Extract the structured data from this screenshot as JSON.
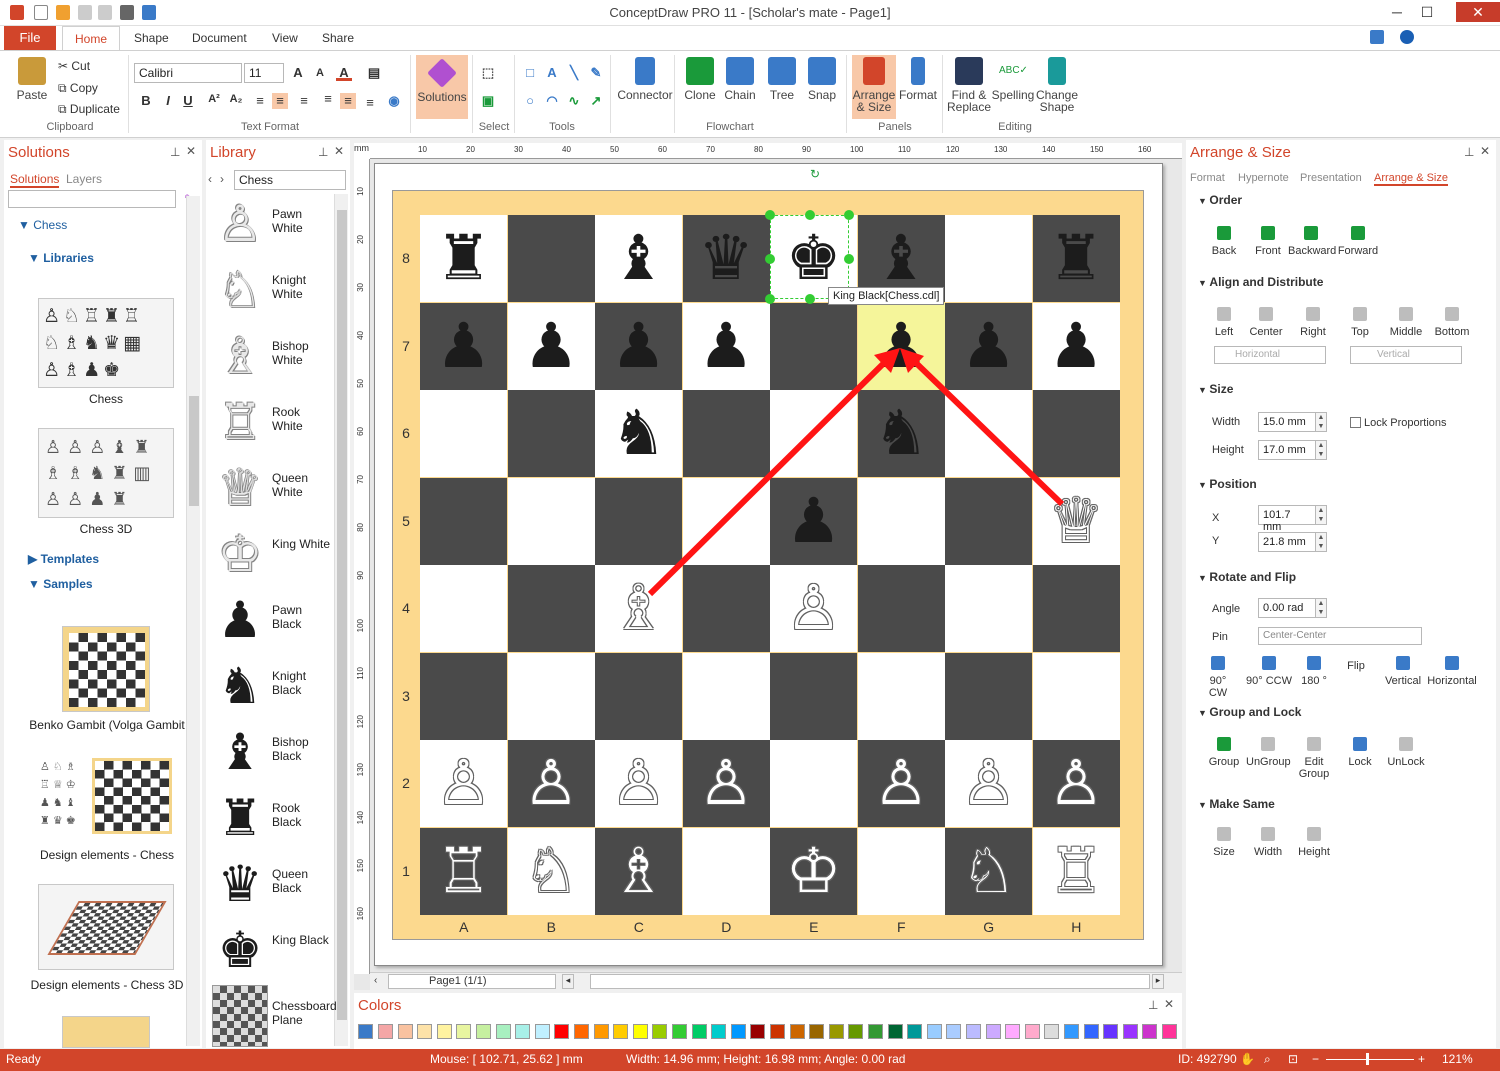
{
  "window": {
    "title": "ConceptDraw PRO 11 - [Scholar's mate - Page1]"
  },
  "tabs": [
    "File",
    "Home",
    "Shape",
    "Document",
    "View",
    "Share"
  ],
  "ribbon": {
    "clipboard": {
      "paste": "Paste",
      "cut": "Cut",
      "copy": "Copy",
      "duplicate": "Duplicate",
      "label": "Clipboard"
    },
    "text_format": {
      "font": "Calibri",
      "size": "11",
      "label": "Text Format"
    },
    "solutions": "Solutions",
    "select_label": "Select",
    "tools_label": "Tools",
    "connector": "Connector",
    "flowchart": {
      "clone": "Clone",
      "chain": "Chain",
      "tree": "Tree",
      "snap": "Snap",
      "label": "Flowchart"
    },
    "panels": {
      "arrange": "Arrange & Size",
      "format": "Format",
      "label": "Panels"
    },
    "editing": {
      "find": "Find & Replace",
      "spelling": "Spelling",
      "change": "Change Shape",
      "label": "Editing"
    }
  },
  "solutions_panel": {
    "title": "Solutions",
    "tabs": [
      "Solutions",
      "Layers"
    ],
    "tree": {
      "root": "Chess",
      "libraries": "Libraries",
      "lib_thumbs": [
        "Chess",
        "Chess 3D"
      ],
      "templates": "Templates",
      "samples": "Samples",
      "sample_thumbs": [
        "Benko Gambit (Volga Gambit",
        "Design elements - Chess",
        "Design elements - Chess 3D"
      ]
    }
  },
  "library_panel": {
    "title": "Library",
    "selected": "Chess",
    "items": [
      {
        "label": "Pawn White",
        "glyph": "♙"
      },
      {
        "label": "Knight White",
        "glyph": "♘"
      },
      {
        "label": "Bishop White",
        "glyph": "♗"
      },
      {
        "label": "Rook White",
        "glyph": "♖"
      },
      {
        "label": "Queen White",
        "glyph": "♕"
      },
      {
        "label": "King White",
        "glyph": "♔"
      },
      {
        "label": "Pawn Black",
        "glyph": "♟"
      },
      {
        "label": "Knight Black",
        "glyph": "♞"
      },
      {
        "label": "Bishop Black",
        "glyph": "♝"
      },
      {
        "label": "Rook Black",
        "glyph": "♜"
      },
      {
        "label": "Queen Black",
        "glyph": "♛"
      },
      {
        "label": "King Black",
        "glyph": "♚"
      },
      {
        "label": "Chessboard Plane",
        "glyph": ""
      }
    ]
  },
  "board": {
    "files": [
      "A",
      "B",
      "C",
      "D",
      "E",
      "F",
      "G",
      "H"
    ],
    "ranks": [
      "8",
      "7",
      "6",
      "5",
      "4",
      "3",
      "2",
      "1"
    ],
    "pieces": [
      [
        "♜",
        "",
        "♝",
        "♛",
        "♚",
        "♝",
        "",
        "♜"
      ],
      [
        "♟",
        "♟",
        "♟",
        "♟",
        "",
        "♟",
        "♟",
        "♟"
      ],
      [
        "",
        "",
        "♞",
        "",
        "",
        "♞",
        "",
        ""
      ],
      [
        "",
        "",
        "",
        "",
        "♟",
        "",
        "",
        "♕"
      ],
      [
        "",
        "",
        "♗",
        "",
        "♙",
        "",
        "",
        ""
      ],
      [
        "",
        "",
        "",
        "",
        "",
        "",
        "",
        ""
      ],
      [
        "♙",
        "♙",
        "♙",
        "♙",
        "",
        "♙",
        "♙",
        "♙"
      ],
      [
        "♖",
        "♘",
        "♗",
        "",
        "♔",
        "",
        "♘",
        "♖"
      ]
    ],
    "tooltip": "King Black[Chess.cdl]",
    "ruler_labels": [
      "10",
      "20",
      "30",
      "40",
      "50",
      "60",
      "70",
      "80",
      "90",
      "100",
      "110",
      "120",
      "130",
      "140",
      "150",
      "160"
    ],
    "ruler_unit": "mm",
    "highlight_color": "#f5f59a"
  },
  "page_nav": {
    "page": "Page1 (1/1)"
  },
  "colors_panel": {
    "title": "Colors",
    "swatches": [
      "#f4a6a6",
      "#f9c2a0",
      "#fde2a8",
      "#fff3a0",
      "#e8f5a0",
      "#c6f0a0",
      "#a8f0c0",
      "#a8f0e8",
      "#c0f0ff",
      "#ff0000",
      "#ff6600",
      "#ff9900",
      "#ffcc00",
      "#ffff00",
      "#99cc00",
      "#33cc33",
      "#00cc66",
      "#00cccc",
      "#0099ff",
      "#990000",
      "#cc3300",
      "#cc6600",
      "#996600",
      "#999900",
      "#669900",
      "#339933",
      "#006633",
      "#009999",
      "#99ccff",
      "#aaccff",
      "#bbbbff",
      "#ccaaff",
      "#ffaaff",
      "#ffaacc",
      "#dddddd",
      "#3399ff",
      "#3366ff",
      "#6633ff",
      "#9933ff",
      "#cc33cc",
      "#ff3399"
    ]
  },
  "arrange_panel": {
    "title": "Arrange & Size",
    "tabs": [
      "Format",
      "Hypernote",
      "Presentation",
      "Arrange & Size"
    ],
    "order": {
      "head": "Order",
      "buttons": [
        "Back",
        "Front",
        "Backward",
        "Forward"
      ]
    },
    "align": {
      "head": "Align and Distribute",
      "buttons": [
        "Left",
        "Center",
        "Right",
        "Top",
        "Middle",
        "Bottom"
      ],
      "horizontal": "Horizontal",
      "vertical": "Vertical"
    },
    "size": {
      "head": "Size",
      "width_label": "Width",
      "width": "15.0 mm",
      "height_label": "Height",
      "height": "17.0 mm",
      "lock": "Lock Proportions"
    },
    "position": {
      "head": "Position",
      "x_label": "X",
      "x": "101.7 mm",
      "y_label": "Y",
      "y": "21.8 mm"
    },
    "rotate": {
      "head": "Rotate and Flip",
      "angle_label": "Angle",
      "angle": "0.00 rad",
      "pin_label": "Pin",
      "pin": "Center-Center",
      "buttons": [
        "90° CW",
        "90° CCW",
        "180 °",
        "Flip",
        "Vertical",
        "Horizontal"
      ]
    },
    "group": {
      "head": "Group and Lock",
      "buttons": [
        "Group",
        "UnGroup",
        "Edit Group",
        "Lock",
        "UnLock"
      ]
    },
    "make_same": {
      "head": "Make Same",
      "buttons": [
        "Size",
        "Width",
        "Height"
      ]
    }
  },
  "status": {
    "ready": "Ready",
    "mouse": "Mouse: [ 102.71, 25.62 ] mm",
    "dims": "Width: 14.96 mm;  Height: 16.98 mm;  Angle: 0.00 rad",
    "id": "ID: 492790",
    "zoom": "121%"
  }
}
